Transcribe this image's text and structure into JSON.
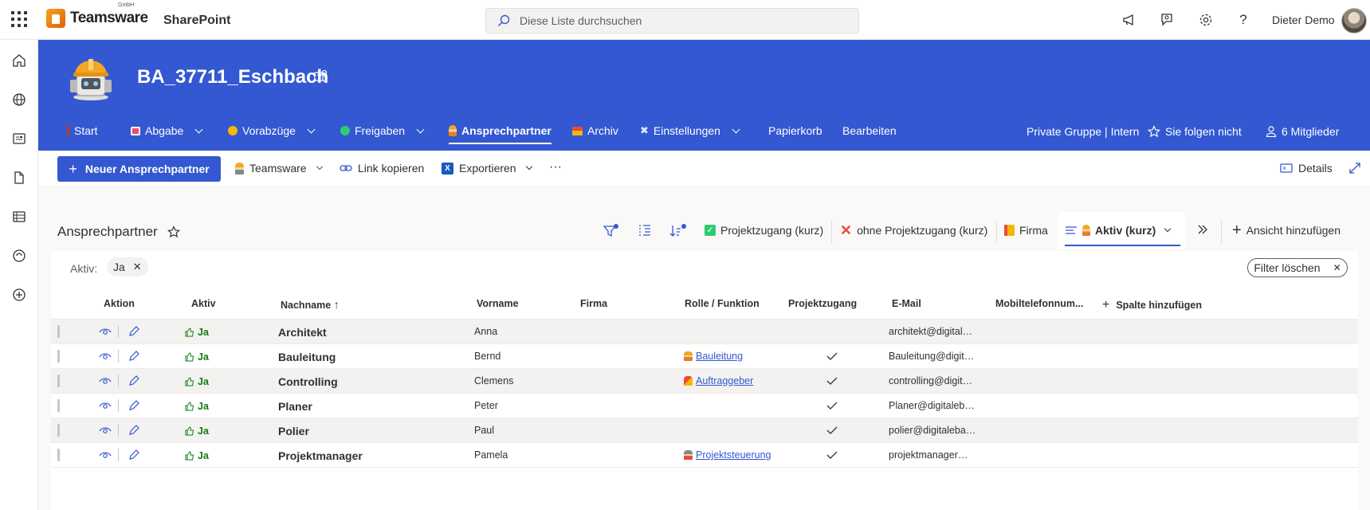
{
  "topbar": {
    "brand": "Teamsware",
    "brand_suffix": "GmbH",
    "app": "SharePoint",
    "search_placeholder": "Diese Liste durchsuchen",
    "user": "Dieter Demo"
  },
  "site": {
    "title": "BA_37711_Eschbach"
  },
  "nav": {
    "items": [
      {
        "label": "Start",
        "dropdown": false
      },
      {
        "label": "Abgabe",
        "dropdown": true
      },
      {
        "label": "Vorabzüge",
        "dropdown": true
      },
      {
        "label": "Freigaben",
        "dropdown": true
      },
      {
        "label": "Ansprechpartner",
        "dropdown": false,
        "active": true
      },
      {
        "label": "Archiv",
        "dropdown": false
      },
      {
        "label": "Einstellungen",
        "dropdown": true
      },
      {
        "label": "Papierkorb",
        "dropdown": false
      },
      {
        "label": "Bearbeiten",
        "dropdown": false
      }
    ],
    "group": "Private Gruppe | Intern",
    "follow": "Sie folgen nicht",
    "members": "6 Mitglieder"
  },
  "commands": {
    "new": "Neuer Ansprechpartner",
    "teamsware": "Teamsware",
    "copy_link": "Link kopieren",
    "export": "Exportieren",
    "more": "···",
    "details": "Details"
  },
  "list": {
    "title": "Ansprechpartner",
    "views": [
      "Projektzugang (kurz)",
      "ohne Projektzugang (kurz)",
      "Firma",
      "Aktiv (kurz)"
    ],
    "add_view": "Ansicht hinzufügen",
    "filter_label": "Aktiv:",
    "filter_value": "Ja",
    "clear_filter": "Filter löschen",
    "columns": [
      "Aktion",
      "Aktiv",
      "Nachname",
      "Vorname",
      "Firma",
      "Rolle / Funktion",
      "Projektzugang",
      "E-Mail",
      "Mobiltelefonnum...",
      "Spalte hinzufügen"
    ],
    "rows": [
      {
        "aktiv": "Ja",
        "nachname": "Architekt",
        "vorname": "Anna",
        "rolle": "",
        "projektzugang": false,
        "email": "architekt@digitaleb..."
      },
      {
        "aktiv": "Ja",
        "nachname": "Bauleitung",
        "vorname": "Bernd",
        "rolle": "Bauleitung",
        "projektzugang": true,
        "email": "Bauleitung@digital..."
      },
      {
        "aktiv": "Ja",
        "nachname": "Controlling",
        "vorname": "Clemens",
        "rolle": "Auftraggeber",
        "projektzugang": true,
        "email": "controlling@digital..."
      },
      {
        "aktiv": "Ja",
        "nachname": "Planer",
        "vorname": "Peter",
        "rolle": "",
        "projektzugang": true,
        "email": "Planer@digitalebau..."
      },
      {
        "aktiv": "Ja",
        "nachname": "Polier",
        "vorname": "Paul",
        "rolle": "",
        "projektzugang": true,
        "email": "polier@digitalebau..."
      },
      {
        "aktiv": "Ja",
        "nachname": "Projektmanager",
        "vorname": "Pamela",
        "rolle": "Projektsteuerung",
        "projektzugang": true,
        "email": "projektmanager@d..."
      }
    ]
  },
  "colors": {
    "brand_blue": "#3358d1",
    "active_green": "#107c10"
  }
}
